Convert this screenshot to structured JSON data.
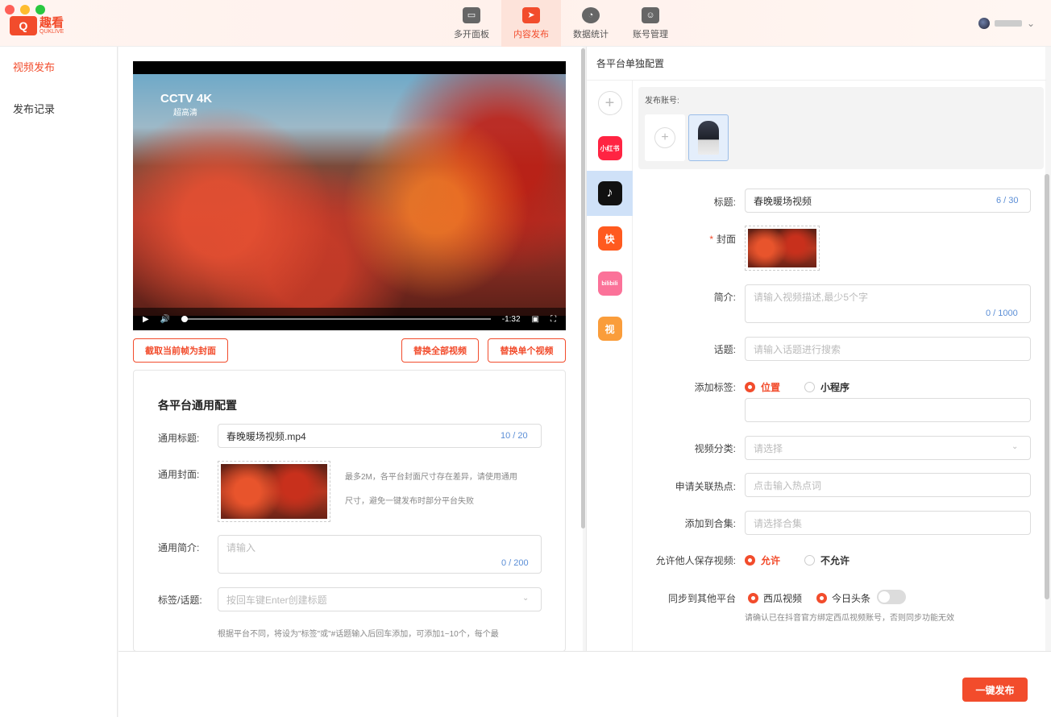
{
  "app": {
    "logo_text": "趣看",
    "logo_sub": "QUKLIVE",
    "logo_mark": "Q"
  },
  "nav": [
    {
      "label": "多开面板",
      "icon": "window-icon"
    },
    {
      "label": "内容发布",
      "icon": "send-icon"
    },
    {
      "label": "数据统计",
      "icon": "pie-chart-icon"
    },
    {
      "label": "账号管理",
      "icon": "account-icon"
    }
  ],
  "sidebar": {
    "items": [
      {
        "label": "视频发布"
      },
      {
        "label": "发布记录"
      }
    ]
  },
  "video": {
    "watermark": "CCTV 4K",
    "watermark_sub": "超高清",
    "time": "-1:32",
    "progress": 0.0
  },
  "video_buttons": {
    "capture_cover": "截取当前帧为封面",
    "replace_all": "替换全部视频",
    "replace_single": "替换单个视频"
  },
  "common": {
    "title": "各平台通用配置",
    "title_label": "通用标题:",
    "title_value": "春晚暖场视频.mp4",
    "title_count": "10 / 20",
    "cover_label": "通用封面:",
    "cover_hint_1": "最多2M，各平台封面尺寸存在差异，请使用通用",
    "cover_hint_2": "尺寸，避免一键发布时部分平台失败",
    "desc_label": "通用简介:",
    "desc_placeholder": "请输入",
    "desc_count": "0 / 200",
    "tags_label": "标签/话题:",
    "tags_placeholder": "按回车键Enter创建标题",
    "tags_hint": "根据平台不同，将设为\"标签\"或\"#话题输入后回车添加，可添加1~10个，每个最"
  },
  "right": {
    "header": "各平台单独配置",
    "platforms": [
      {
        "name": "add",
        "label": "+"
      },
      {
        "name": "xiaohongshu",
        "label": "小红书",
        "color": "#ff2442"
      },
      {
        "name": "douyin",
        "label": "♪",
        "color": "#111111"
      },
      {
        "name": "kuaishou",
        "label": "快",
        "color": "#ff5a1f"
      },
      {
        "name": "bilibili",
        "label": "bilibili",
        "color": "#fb7299"
      },
      {
        "name": "wechat-channels",
        "label": "视",
        "color": "#fa9d3b"
      }
    ],
    "account_label": "发布账号:",
    "title_label": "标题:",
    "title_value": "春晚暖场视频",
    "title_count": "6 / 30",
    "cover_label": "封面",
    "desc_label": "简介:",
    "desc_placeholder": "请输入视频描述,最少5个字",
    "desc_count": "0 / 1000",
    "topic_label": "话题:",
    "topic_placeholder": "请输入话题进行搜索",
    "tag_label": "添加标签:",
    "tag_opt_location": "位置",
    "tag_opt_miniprogram": "小程序",
    "category_label": "视频分类:",
    "category_placeholder": "请选择",
    "hotspot_label": "申请关联热点:",
    "hotspot_placeholder": "点击输入热点词",
    "collection_label": "添加到合集:",
    "collection_placeholder": "请选择合集",
    "allow_save_label": "允许他人保存视频:",
    "allow_yes": "允许",
    "allow_no": "不允许",
    "sync_label": "同步到其他平台",
    "sync_xigua": "西瓜视频",
    "sync_toutiao": "今日头条",
    "sync_hint": "请确认已在抖音官方绑定西瓜视频账号，否则同步功能无效"
  },
  "publish_button": "一键发布",
  "colors": {
    "accent": "#f24c2c",
    "counter": "#5b8ed6"
  }
}
